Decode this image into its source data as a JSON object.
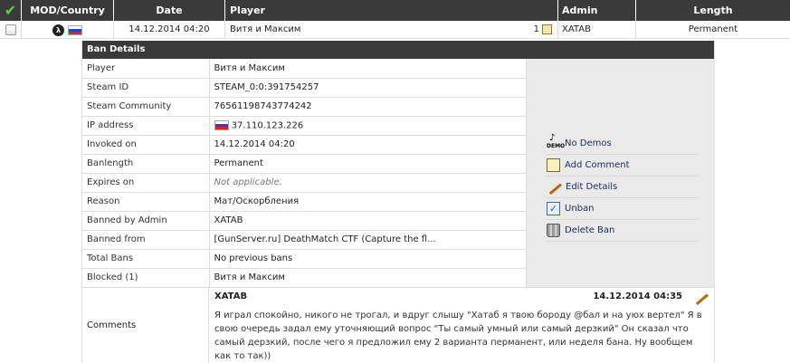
{
  "header": {
    "mod_country": "MOD/Country",
    "date": "Date",
    "player": "Player",
    "admin": "Admin",
    "length": "Length"
  },
  "row": {
    "date": "14.12.2014 04:20",
    "player": "Витя и Максим",
    "comment_count": "1",
    "admin": "XATAB",
    "length": "Permanent"
  },
  "details": {
    "title": "Ban Details",
    "rows": [
      {
        "label": "Player",
        "value": "Витя и Максим"
      },
      {
        "label": "Steam ID",
        "value": "STEAM_0:0:391754257"
      },
      {
        "label": "Steam Community",
        "value": "76561198743774242"
      },
      {
        "label": "IP address",
        "value": "37.110.123.226"
      },
      {
        "label": "Invoked on",
        "value": "14.12.2014 04:20"
      },
      {
        "label": "Banlength",
        "value": "Permanent"
      },
      {
        "label": "Expires on",
        "value": "Not applicable."
      },
      {
        "label": "Reason",
        "value": "Мат/Оскорбления"
      },
      {
        "label": "Banned by Admin",
        "value": "XATAB"
      },
      {
        "label": "Banned from",
        "value": "[GunServer.ru] DeathMatch CTF (Capture the fl..."
      },
      {
        "label": "Total Bans",
        "value": "No previous bans"
      },
      {
        "label": "Blocked (1)",
        "value": "Витя и Максим"
      }
    ]
  },
  "actions": {
    "no_demos": "No Demos",
    "add_comment": "Add Comment",
    "edit_details": "Edit Details",
    "unban": "Unban",
    "delete_ban": "Delete Ban"
  },
  "comments": {
    "label": "Comments",
    "author": "XATAB",
    "date": "14.12.2014 04:35",
    "text": "Я играл спокойно, никого не трогал, и вдруг слышу \"Хатаб я твою бороду @бал и на уюх вертел\" Я в свою очередь задал ему уточняющий вопрос \"Ты самый умный или самый дерзкий\" Он сказал что самый дерзкий, после чего я предложил ему 2 варианта перманент, или неделя бана. Ну вообщем как то так))"
  },
  "icons": {
    "mod": "mod-icon",
    "flag": "russia-flag-icon"
  },
  "colors": {
    "header_bg": "#3a3a3a",
    "panel_bg": "#eaeaea",
    "check_green": "#5fcf3a"
  }
}
